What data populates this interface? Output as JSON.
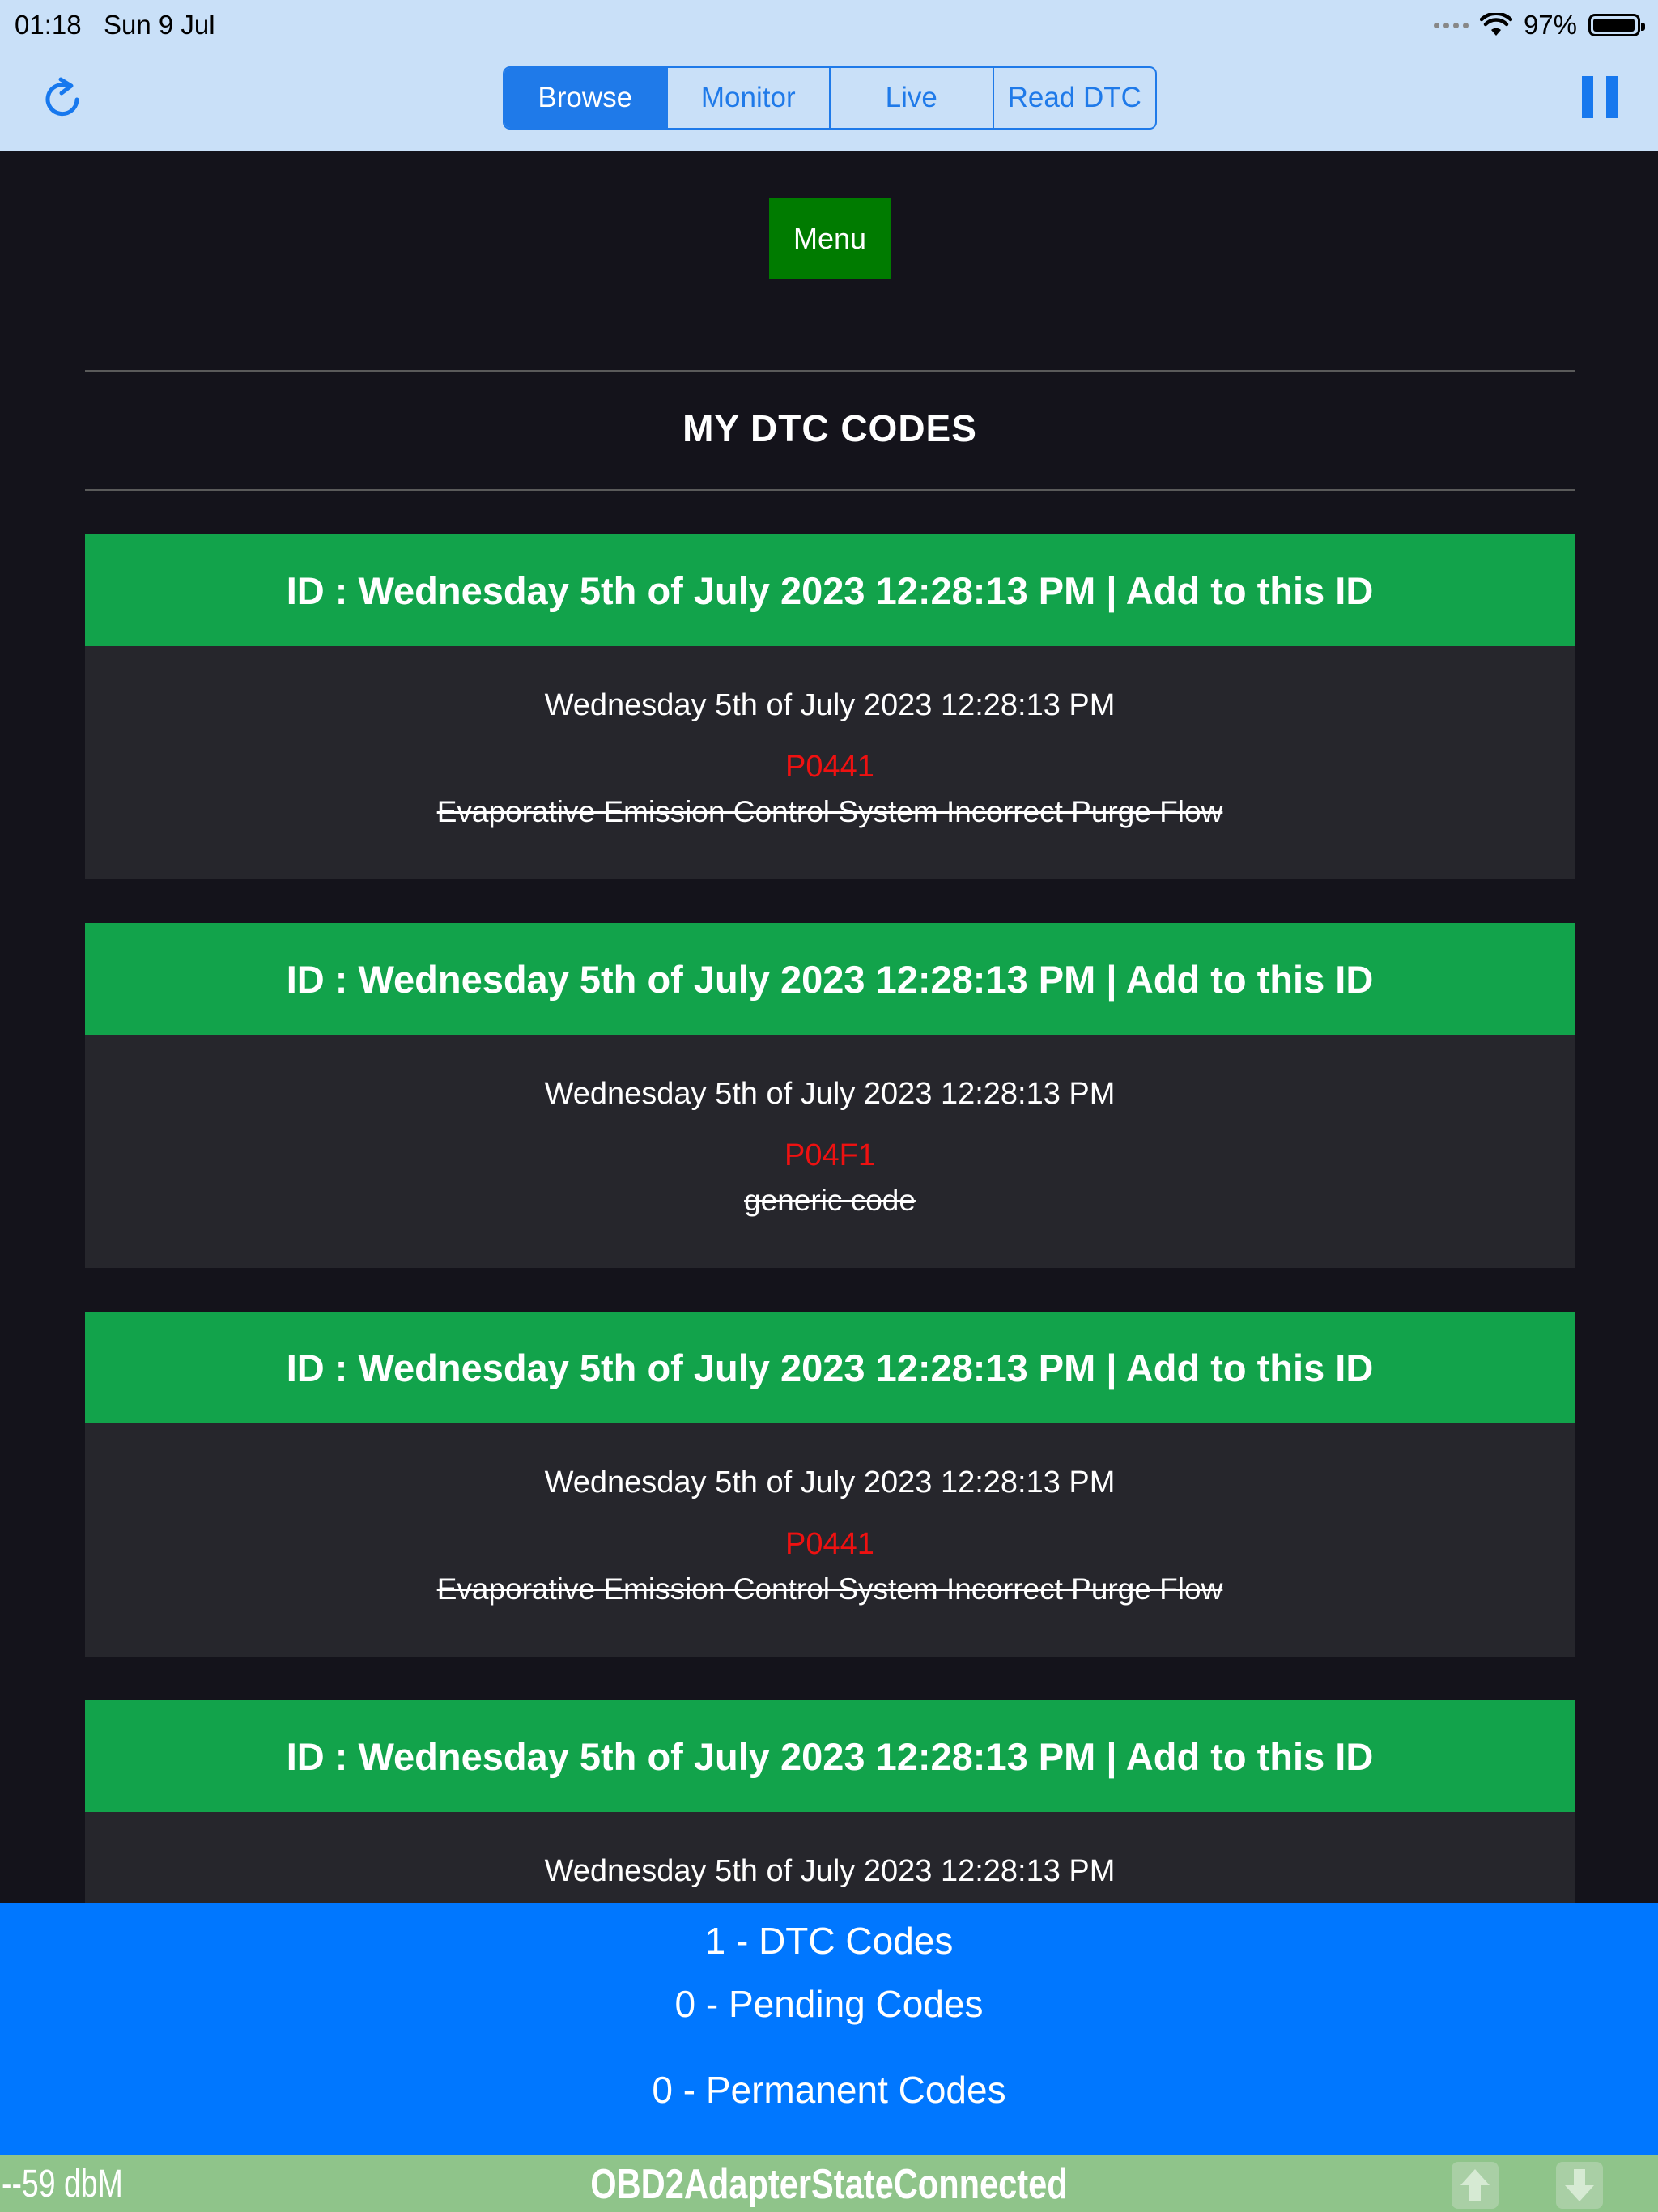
{
  "status": {
    "time": "01:18",
    "date": "Sun 9 Jul",
    "battery": "97%"
  },
  "nav": {
    "segments": [
      "Browse",
      "Monitor",
      "Live",
      "Read DTC"
    ],
    "selected": "Browse",
    "refresh_icon": "refresh-icon",
    "pause_icon": "pause-icon"
  },
  "menu_label": "Menu",
  "page_title": "MY DTC CODES",
  "cards": [
    {
      "header": "ID : Wednesday 5th of July 2023 12:28:13 PM | Add to this ID",
      "date": "Wednesday 5th of July 2023 12:28:13 PM",
      "code": "P0441",
      "description": "Evaporative Emission Control System Incorrect Purge Flow"
    },
    {
      "header": "ID : Wednesday 5th of July 2023 12:28:13 PM | Add to this ID",
      "date": "Wednesday 5th of July 2023 12:28:13 PM",
      "code": "P04F1",
      "description": "generic code"
    },
    {
      "header": "ID : Wednesday 5th of July 2023 12:28:13 PM | Add to this ID",
      "date": "Wednesday 5th of July 2023 12:28:13 PM",
      "code": "P0441",
      "description": "Evaporative Emission Control System Incorrect Purge Flow"
    },
    {
      "header": "ID : Wednesday 5th of July 2023 12:28:13 PM | Add to this ID",
      "date": "Wednesday 5th of July 2023 12:28:13 PM",
      "code": "",
      "description": ""
    }
  ],
  "summary": {
    "dtc": "1 - DTC Codes",
    "pending": "0 - Pending Codes",
    "permanent": "0 - Permanent Codes"
  },
  "adapter": {
    "signal": "--59 dbM",
    "state": "OBD2AdapterStateConnected"
  },
  "colors": {
    "nav_bg": "#c9e0f8",
    "accent": "#1f7ae9",
    "card_header": "#12a34b",
    "code_red": "#ee1111",
    "summary_bg": "#0077ff",
    "adapter_bg": "#8fc48a"
  }
}
